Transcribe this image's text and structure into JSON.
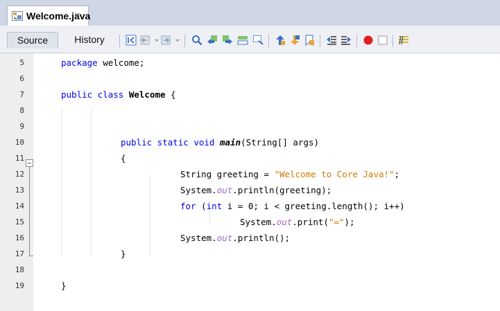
{
  "tab": {
    "title": "Welcome.java",
    "close": "×"
  },
  "toolbar": {
    "source_label": "Source",
    "history_label": "History"
  },
  "editor": {
    "line_numbers": [
      "5",
      "6",
      "7",
      "8",
      "9",
      "10",
      "11",
      "12",
      "13",
      "14",
      "15",
      "16",
      "17",
      "18",
      "19"
    ],
    "code": {
      "l5_kw": "package",
      "l5_rest": " welcome;",
      "l7_kw": "public class",
      "l7_cls": "Welcome",
      "l7_rest": " {",
      "l10_kw": "public static void",
      "l10_name": "main",
      "l10_rest": "(String[] args)",
      "l11": "{",
      "l12_a": "String greeting = ",
      "l12_str": "\"Welcome to Core Java!\"",
      "l12_b": ";",
      "l13_a": "System.",
      "l13_fld": "out",
      "l13_b": ".println(greeting);",
      "l14_kw1": "for",
      "l14_a": " (",
      "l14_kw2": "int",
      "l14_b": " i = 0; i < greeting.length(); i++)",
      "l15_a": "System.",
      "l15_fld": "out",
      "l15_b": ".print(",
      "l15_str": "\"=\"",
      "l15_c": ");",
      "l16_a": "System.",
      "l16_fld": "out",
      "l16_b": ".println();",
      "l17": "}",
      "l19": "}"
    }
  },
  "colors": {
    "keyword": "#0000e6",
    "string": "#ce7b00",
    "field": "#a36ac7"
  }
}
